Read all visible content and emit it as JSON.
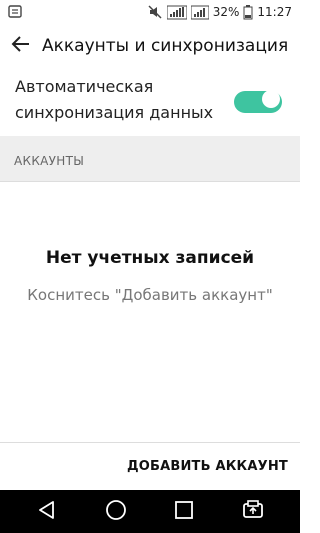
{
  "status_bar": {
    "battery_percent": "32%",
    "time": "11:27"
  },
  "app_bar": {
    "title": "Аккаунты и синхронизация"
  },
  "auto_sync": {
    "label": "Автоматическая синхронизация данных",
    "enabled": true
  },
  "accounts_section": {
    "header": "АККАУНТЫ"
  },
  "empty_state": {
    "title": "Нет учетных записей",
    "hint": "Коснитесь \"Добавить аккаунт\""
  },
  "actions": {
    "add_account_label": "ДОБАВИТЬ АККАУНТ"
  },
  "nav_bar": {
    "buttons": [
      "back-icon",
      "home-icon",
      "recents-icon",
      "dual-window-icon"
    ]
  },
  "colors": {
    "accent": "#3ec4a0",
    "section_bg": "#eeeeee",
    "nav_bg": "#000000"
  }
}
